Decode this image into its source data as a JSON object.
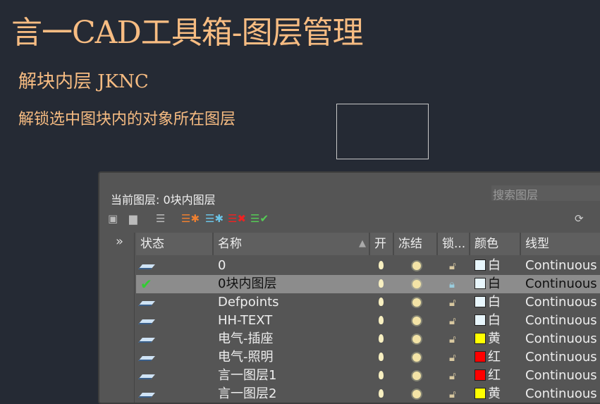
{
  "title": "言一CAD工具箱-图层管理",
  "subtitle": "解块内层 JKNC",
  "description": "解锁选中图块内的对象所在图层",
  "panel": {
    "current_layer": "当前图层: 0块内图层",
    "search_placeholder": "搜索图层",
    "expand": "»",
    "columns": {
      "status": "状态",
      "name": "名称",
      "on": "开",
      "freeze": "冻结",
      "lock": "锁...",
      "color": "颜色",
      "linetype": "线型"
    },
    "rows": [
      {
        "name": "0",
        "color_name": "白",
        "color": "#e8f6fc",
        "linetype": "Continuous",
        "current": false,
        "locked": false
      },
      {
        "name": "0块内图层",
        "color_name": "白",
        "color": "#e8f6fc",
        "linetype": "Continuous",
        "current": true,
        "locked": true
      },
      {
        "name": "Defpoints",
        "color_name": "白",
        "color": "#e8f6fc",
        "linetype": "Continuous",
        "current": false,
        "locked": false
      },
      {
        "name": "HH-TEXT",
        "color_name": "白",
        "color": "#e8f6fc",
        "linetype": "Continuous",
        "current": false,
        "locked": false
      },
      {
        "name": "电气-插座",
        "color_name": "黄",
        "color": "#ffff00",
        "linetype": "Continuous",
        "current": false,
        "locked": false
      },
      {
        "name": "电气-照明",
        "color_name": "红",
        "color": "#ff0000",
        "linetype": "Continuous",
        "current": false,
        "locked": false
      },
      {
        "name": "言一图层1",
        "color_name": "红",
        "color": "#ff0000",
        "linetype": "Continuous",
        "current": false,
        "locked": false
      },
      {
        "name": "言一图层2",
        "color_name": "黄",
        "color": "#ffff00",
        "linetype": "Continuous",
        "current": false,
        "locked": false
      }
    ]
  }
}
